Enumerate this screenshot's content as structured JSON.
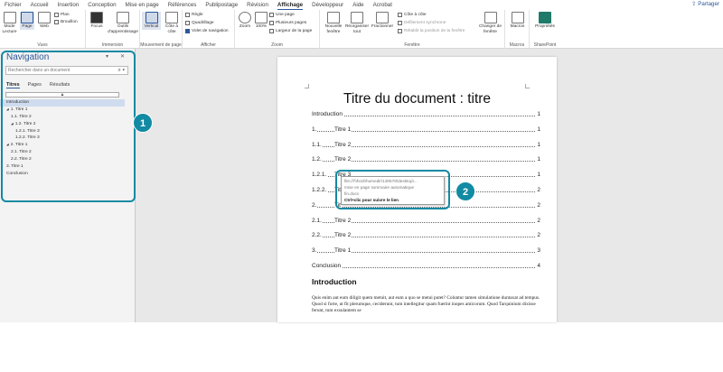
{
  "menu": {
    "tabs": [
      "Fichier",
      "Accueil",
      "Insertion",
      "Conception",
      "Mise en page",
      "Références",
      "Publipostage",
      "Révision",
      "Affichage",
      "Développeur",
      "Aide",
      "Acrobat"
    ],
    "active": "Affichage",
    "share": "Partager"
  },
  "ribbon": {
    "vues": {
      "label": "Vues",
      "mode_lecture": "Mode Lecture",
      "page": "Page",
      "web": "Web",
      "plan": "Plan",
      "brouillon": "Brouillon"
    },
    "immersion": {
      "label": "Immersion",
      "focus": "Focus",
      "outils": "Outils d'apprentissage"
    },
    "mouvement": {
      "label": "Mouvement de page",
      "vertical": "Vertical",
      "cote": "Côte à côte"
    },
    "afficher": {
      "label": "Afficher",
      "regle": "Règle",
      "quadrillage": "Quadrillage",
      "volet": "Volet de navigation"
    },
    "zoom": {
      "label": "Zoom",
      "zoom": "Zoom",
      "cent": "100%",
      "une_page": "Une page",
      "plusieurs": "Plusieurs pages",
      "largeur": "Largeur de la page"
    },
    "fenetre": {
      "label": "Fenêtre",
      "nouvelle": "Nouvelle fenêtre",
      "reorganiser": "Réorganiser tout",
      "fractionner": "Fractionner",
      "cote_a_cote": "Côte à côte",
      "defilement": "Défilement synchrone",
      "retablir": "Rétablir la position de la fenêtre",
      "changer": "Changer de fenêtre"
    },
    "macros": {
      "label": "Macros",
      "macros": "Macros"
    },
    "sharepoint": {
      "label": "SharePoint",
      "proprietes": "Propriétés"
    }
  },
  "nav": {
    "title": "Navigation",
    "search_placeholder": "Rechercher dans un document",
    "tabs": [
      "Titres",
      "Pages",
      "Résultats"
    ],
    "active_tab": "Titres",
    "items": [
      {
        "label": "Introduction",
        "indent": 0,
        "arrow": ""
      },
      {
        "label": "1. Titre 1",
        "indent": 0,
        "arrow": "◢"
      },
      {
        "label": "1.1. Titre 2",
        "indent": 1,
        "arrow": ""
      },
      {
        "label": "1.2. Titre 2",
        "indent": 1,
        "arrow": "◢"
      },
      {
        "label": "1.2.1. Titre 3",
        "indent": 2,
        "arrow": ""
      },
      {
        "label": "1.2.2. Titre 3",
        "indent": 2,
        "arrow": ""
      },
      {
        "label": "2. Titre 1",
        "indent": 0,
        "arrow": "◢"
      },
      {
        "label": "2.1. Titre 2",
        "indent": 1,
        "arrow": ""
      },
      {
        "label": "2.2. Titre 2",
        "indent": 1,
        "arrow": ""
      },
      {
        "label": "3. Titre 1",
        "indent": 0,
        "arrow": ""
      },
      {
        "label": "Conclusion",
        "indent": 0,
        "arrow": ""
      }
    ]
  },
  "callouts": {
    "one": "1",
    "two": "2"
  },
  "document": {
    "title": "Titre du document : titre",
    "toc": [
      {
        "num": "",
        "title": "Introduction",
        "page": "1"
      },
      {
        "num": "1.",
        "title": "Titre 1",
        "page": "1"
      },
      {
        "num": "1.1.",
        "title": "Titre 2",
        "page": "1"
      },
      {
        "num": "1.2.",
        "title": "Titre 2",
        "page": "1"
      },
      {
        "num": "1.2.1.",
        "title": "Titre 3",
        "page": "1"
      },
      {
        "num": "1.2.2.",
        "title": "Tit",
        "page": "2"
      },
      {
        "num": "2.",
        "title": "Tit",
        "page": "2"
      },
      {
        "num": "2.1.",
        "title": "Titre 2",
        "page": "2"
      },
      {
        "num": "2.2.",
        "title": "Titre 2",
        "page": "2"
      },
      {
        "num": "3.",
        "title": "Titre 1",
        "page": "3"
      },
      {
        "num": "",
        "title": "Conclusion",
        "page": "4"
      }
    ],
    "tooltip": {
      "path": "file:///\\\\fs19\\homedir\\130678\\desktop\\...",
      "name1": "mise en page sommaire automatique",
      "name2": "fin.docx",
      "action": "Ctrl+clic pour suivre le lien"
    },
    "intro_heading": "Introduction",
    "paragraph": "Quis enim aut eum diligit quem metuit, aut eum a quo se metui putet? Coluntur tamen simulatione duntaxat ad tempus. Quod si forte, ut fit plerumque, ceciderunt, tum intellegitur quam fuerint inopes amicorum. Quod Tarquinium dixisse ferunt, tum exsulantem se"
  }
}
